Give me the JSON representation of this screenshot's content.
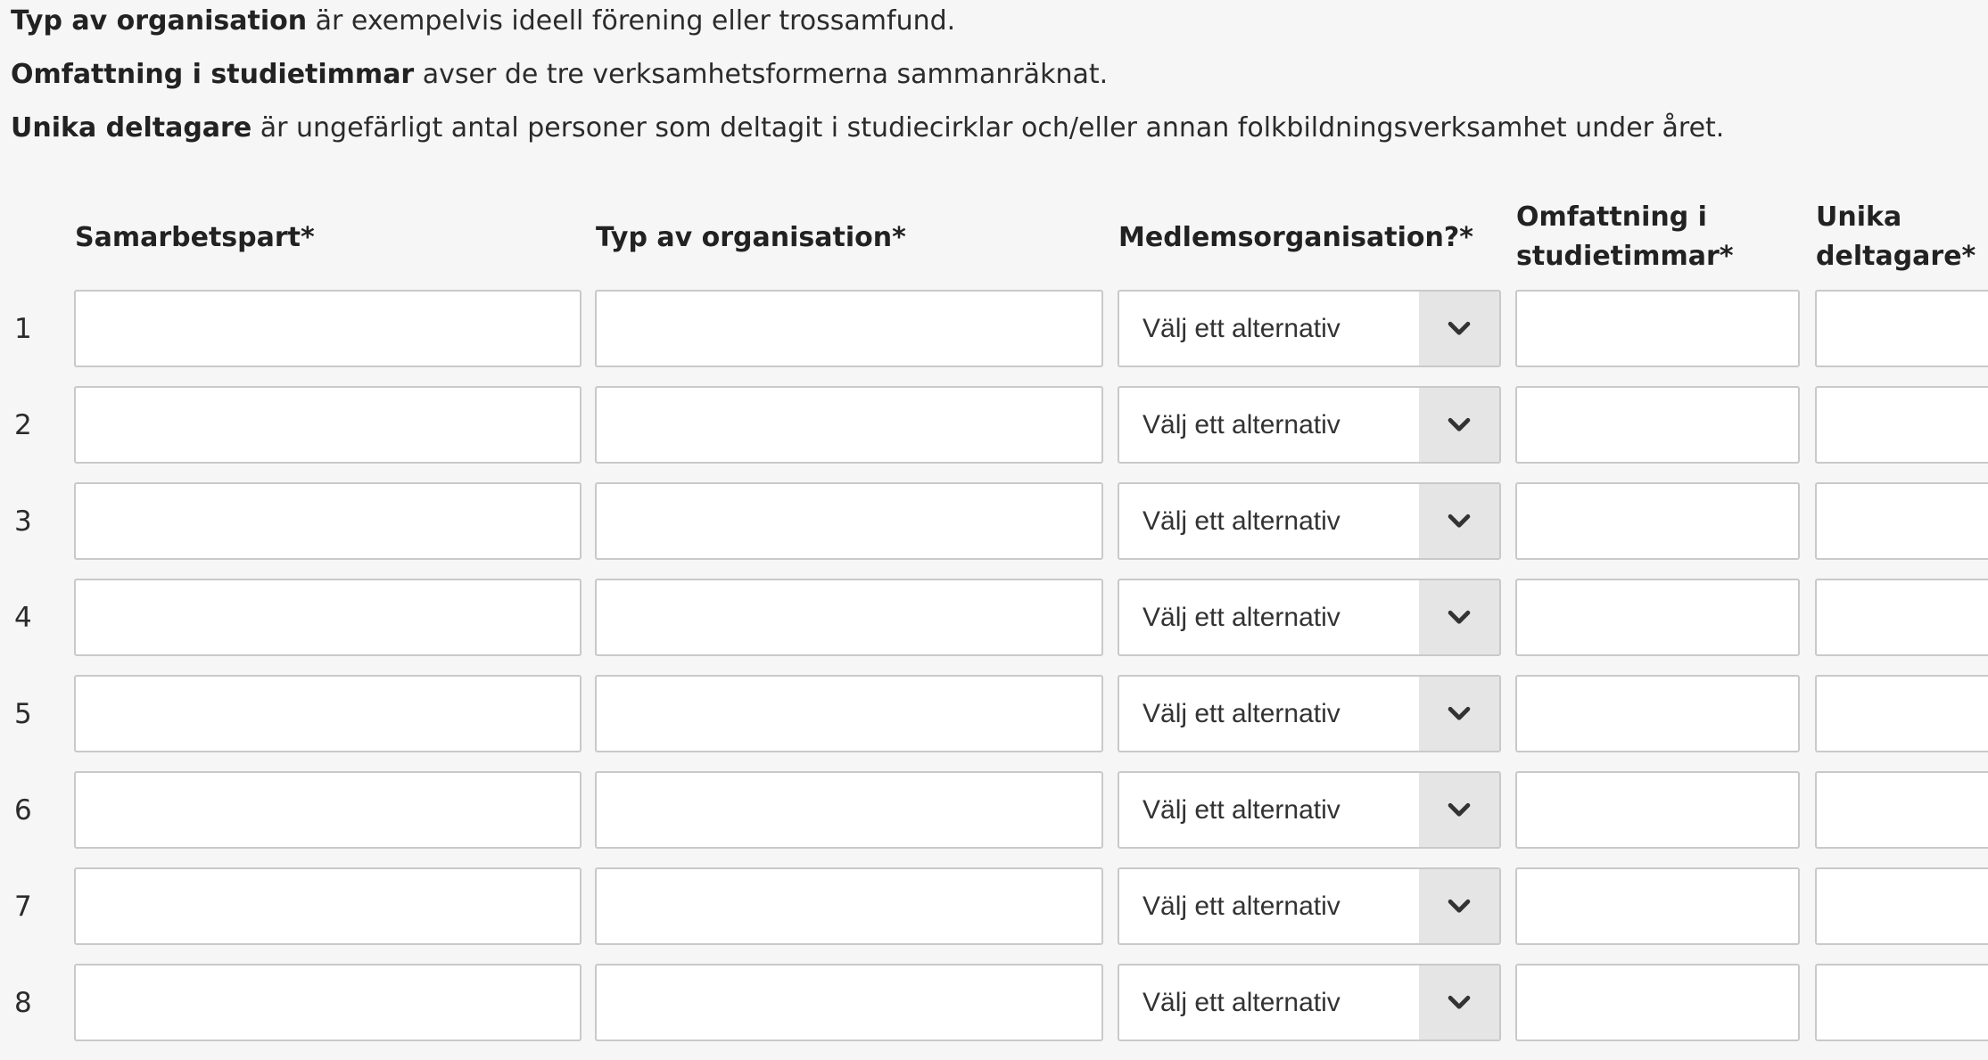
{
  "intro": [
    {
      "term": "Typ av organisation",
      "text": " är exempelvis ideell förening eller trossamfund."
    },
    {
      "term": "Omfattning i studietimmar",
      "text": " avser de tre verksamhetsformerna sammanräknat."
    },
    {
      "term": "Unika deltagare",
      "text": " är ungefärligt antal personer som deltagit i studiecirklar och/eller annan folkbildningsverksamhet under året."
    }
  ],
  "table": {
    "headers": {
      "partner": "Samarbetspart*",
      "org_type": "Typ av organisation*",
      "member": "Medlemsorganisation?*",
      "hours_1": "Omfattning i",
      "hours_2": "studietimmar*",
      "unique_1": "Unika",
      "unique_2": "deltagare*"
    },
    "select_placeholder": "Välj ett alternativ",
    "rows": [
      {
        "num": "1",
        "partner": "",
        "org_type": "",
        "member": "Välj ett alternativ",
        "hours": "",
        "unique": ""
      },
      {
        "num": "2",
        "partner": "",
        "org_type": "",
        "member": "Välj ett alternativ",
        "hours": "",
        "unique": ""
      },
      {
        "num": "3",
        "partner": "",
        "org_type": "",
        "member": "Välj ett alternativ",
        "hours": "",
        "unique": ""
      },
      {
        "num": "4",
        "partner": "",
        "org_type": "",
        "member": "Välj ett alternativ",
        "hours": "",
        "unique": ""
      },
      {
        "num": "5",
        "partner": "",
        "org_type": "",
        "member": "Välj ett alternativ",
        "hours": "",
        "unique": ""
      },
      {
        "num": "6",
        "partner": "",
        "org_type": "",
        "member": "Välj ett alternativ",
        "hours": "",
        "unique": ""
      },
      {
        "num": "7",
        "partner": "",
        "org_type": "",
        "member": "Välj ett alternativ",
        "hours": "",
        "unique": ""
      },
      {
        "num": "8",
        "partner": "",
        "org_type": "",
        "member": "Välj ett alternativ",
        "hours": "",
        "unique": ""
      }
    ]
  },
  "icons": {
    "dropdown": "chevron-down-icon"
  },
  "colors": {
    "background": "#f6f6f6",
    "field_border": "#c9c9c9",
    "select_button": "#e5e5e5",
    "text": "#2b2b2b"
  }
}
